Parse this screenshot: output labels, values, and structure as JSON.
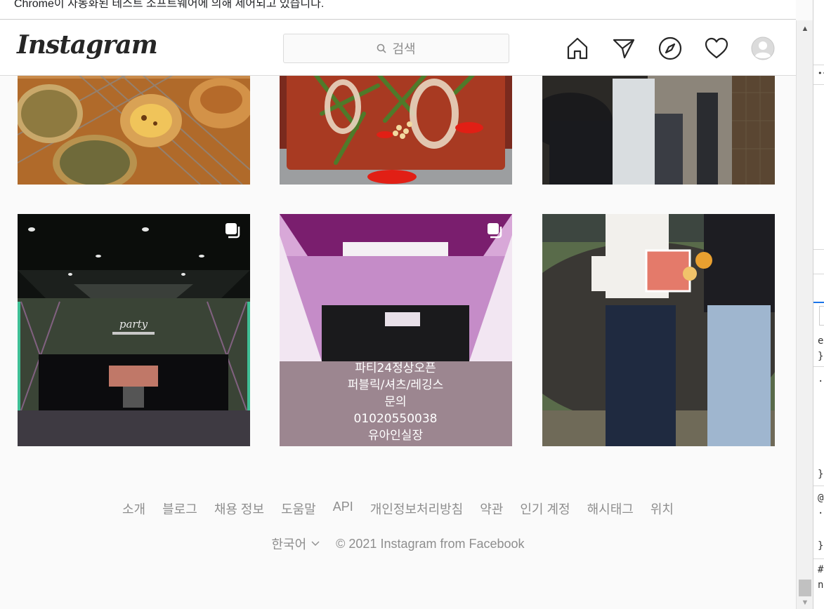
{
  "browser": {
    "infobar_text": "Chrome이 자동화된 테스트 소프트웨어에 의해 제어되고 있습니다."
  },
  "header": {
    "logo": "Instagram",
    "search_placeholder": "검색",
    "nav_icons": [
      "home-icon",
      "direct-send-icon",
      "explore-compass-icon",
      "activity-heart-icon",
      "profile-avatar-icon"
    ]
  },
  "grid": {
    "rows": [
      [
        {
          "name": "egg-tarts-and-pastries-photo",
          "multi": false
        },
        {
          "name": "seafood-stew-photo",
          "multi": false
        },
        {
          "name": "people-in-hallway-photo",
          "multi": false
        }
      ],
      [
        {
          "name": "party-room-photo",
          "multi": true,
          "sign": "party"
        },
        {
          "name": "karaoke-room-ad-photo",
          "multi": true,
          "ad_lines": [
            "파티24정상오픈",
            "퍼블릭/셔츠/레깅스",
            "문의",
            "01020550038",
            "유아인실장"
          ]
        },
        {
          "name": "couple-holding-tart-photo",
          "multi": false
        }
      ]
    ]
  },
  "footer": {
    "links": [
      "소개",
      "블로그",
      "채용 정보",
      "도움말",
      "API",
      "개인정보처리방침",
      "약관",
      "인기 계정",
      "해시태그",
      "위치"
    ],
    "language": "한국어",
    "copyright": "© 2021 Instagram from Facebook"
  },
  "devtools": {
    "fragments": [
      "e",
      "}",
      "·",
      "}",
      "@",
      "·",
      "}",
      "#",
      "n"
    ]
  },
  "colors": {
    "header_bg": "#ffffff",
    "border": "#dbdbdb",
    "text_secondary": "#8e8e8e",
    "page_bg": "#fafafa"
  }
}
